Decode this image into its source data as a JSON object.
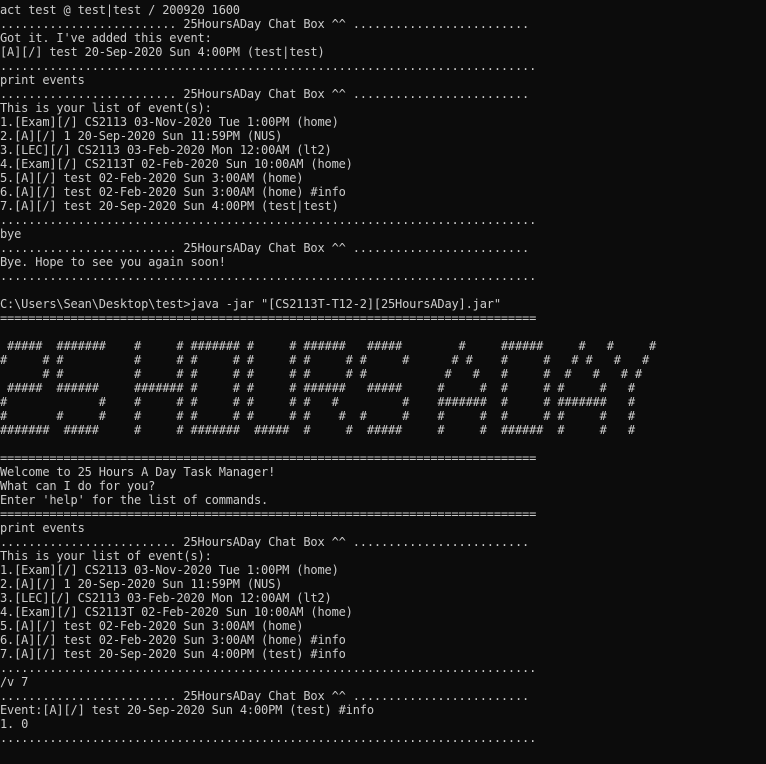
{
  "terminal": {
    "background": "#0c0c0c",
    "foreground": "#cccccc",
    "lines": [
      "act test @ test|test / 200920 1600",
      "......................... 25HoursADay Chat Box ^^ .........................",
      "Got it. I've added this event:",
      "[A][/] test 20-Sep-2020 Sun 4:00PM (test|test)",
      "............................................................................",
      "print events",
      "......................... 25HoursADay Chat Box ^^ .........................",
      "This is your list of event(s):",
      "1.[Exam][/] CS2113 03-Nov-2020 Tue 1:00PM (home)",
      "2.[A][/] 1 20-Sep-2020 Sun 11:59PM (NUS)",
      "3.[LEC][/] CS2113 03-Feb-2020 Mon 12:00AM (lt2)",
      "4.[Exam][/] CS2113T 02-Feb-2020 Sun 10:00AM (home)",
      "5.[A][/] test 02-Feb-2020 Sun 3:00AM (home)",
      "6.[A][/] test 02-Feb-2020 Sun 3:00AM (home) #info",
      "7.[A][/] test 20-Sep-2020 Sun 4:00PM (test|test)",
      "............................................................................",
      "bye",
      "......................... 25HoursADay Chat Box ^^ .........................",
      "Bye. Hope to see you again soon!",
      "............................................................................",
      "",
      "C:\\Users\\Sean\\Desktop\\test>java -jar \"[CS2113T-T12-2][25HoursADay].jar\"",
      "============================================================================",
      "",
      " #####  #######    #     # ####### #     # ######   #####        #     ######     #   #     #",
      "#     # #          #     # #     # #     # #     # #     #      # #    #     #   # #   #   #",
      "      # #          #     # #     # #     # #     # #           #   #   #     #  #   #   # #",
      " #####  ######     ####### #     # #     # ######   #####     #     #  #     # #     #   #",
      "#             #    #     # #     # #     # #   #         #    #######  #     # #######   #",
      "#       #     #    #     # #     # #     # #    #  #     #    #     #  #     # #     #   #",
      "#######  #####     #     # #######  #####  #     #  #####     #     #  ######  #     #   #",
      "",
      "============================================================================",
      "Welcome to 25 Hours A Day Task Manager!",
      "What can I do for you?",
      "Enter 'help' for the list of commands.",
      "============================================================================",
      "print events",
      "......................... 25HoursADay Chat Box ^^ .........................",
      "This is your list of event(s):",
      "1.[Exam][/] CS2113 03-Nov-2020 Tue 1:00PM (home)",
      "2.[A][/] 1 20-Sep-2020 Sun 11:59PM (NUS)",
      "3.[LEC][/] CS2113 03-Feb-2020 Mon 12:00AM (lt2)",
      "4.[Exam][/] CS2113T 02-Feb-2020 Sun 10:00AM (home)",
      "5.[A][/] test 02-Feb-2020 Sun 3:00AM (home)",
      "6.[A][/] test 02-Feb-2020 Sun 3:00AM (home) #info",
      "7.[A][/] test 20-Sep-2020 Sun 4:00PM (test) #info",
      "............................................................................",
      "/v 7",
      "......................... 25HoursADay Chat Box ^^ .........................",
      "Event:[A][/] test 20-Sep-2020 Sun 4:00PM (test) #info",
      "1. 0",
      "............................................................................"
    ]
  }
}
